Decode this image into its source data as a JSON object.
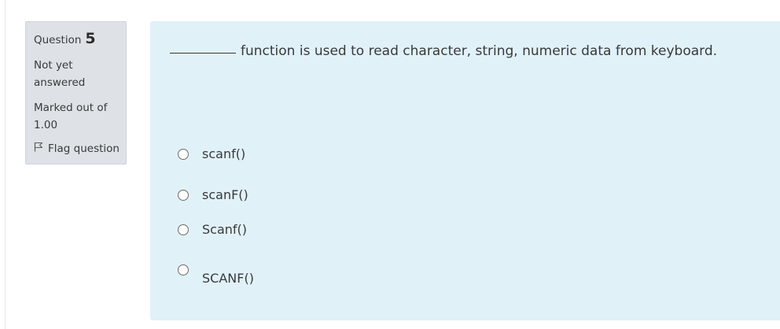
{
  "question": {
    "label": "Question",
    "number": "5",
    "state": "Not yet answered",
    "grade": "Marked out of 1.00",
    "flag_label": "Flag question",
    "flag_icon": "flag-outline-icon",
    "text": "function is used to read character, string, numeric data from keyboard.",
    "options": [
      {
        "label": "scanf()",
        "selected": false
      },
      {
        "label": "scanF()",
        "selected": false
      },
      {
        "label": "Scanf()",
        "selected": false
      },
      {
        "label": "SCANF()",
        "selected": false
      }
    ]
  },
  "colors": {
    "info_background": "#dee2e6",
    "content_background": "#e1f1f8",
    "text": "#373a3c"
  }
}
